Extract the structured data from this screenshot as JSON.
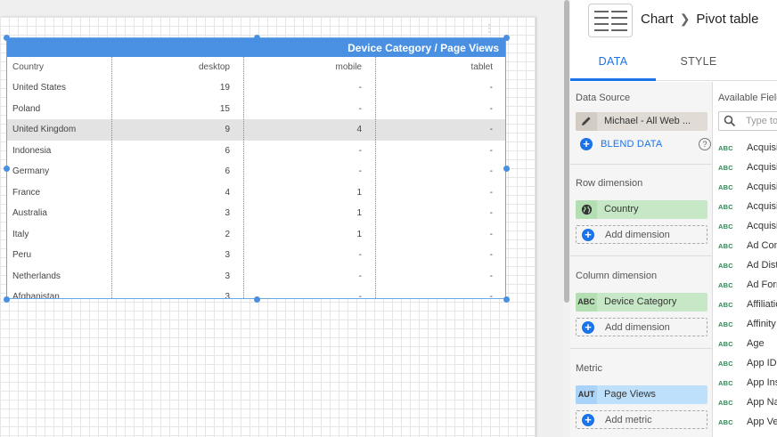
{
  "chart": {
    "header": "Device Category / Page Views",
    "columns": [
      "Country",
      "desktop",
      "mobile",
      "tablet"
    ],
    "rows": [
      [
        "United States",
        "19",
        "-",
        "-"
      ],
      [
        "Poland",
        "15",
        "-",
        "-"
      ],
      [
        "United Kingdom",
        "9",
        "4",
        "-"
      ],
      [
        "Indonesia",
        "6",
        "-",
        "-"
      ],
      [
        "Germany",
        "6",
        "-",
        "-"
      ],
      [
        "France",
        "4",
        "1",
        "-"
      ],
      [
        "Australia",
        "3",
        "1",
        "-"
      ],
      [
        "Italy",
        "2",
        "1",
        "-"
      ],
      [
        "Peru",
        "3",
        "-",
        "-"
      ],
      [
        "Netherlands",
        "3",
        "-",
        "-"
      ],
      [
        "Afghanistan",
        "3",
        "-",
        "-"
      ]
    ]
  },
  "panel": {
    "breadcrumb": {
      "parent": "Chart",
      "current": "Pivot table"
    },
    "tabs": [
      {
        "label": "DATA"
      },
      {
        "label": "STYLE"
      }
    ],
    "data_source": {
      "title": "Data Source",
      "name": "Michael - All Web ...",
      "blend_label": "BLEND DATA"
    },
    "row_dimension": {
      "title": "Row dimension",
      "chip": "Country",
      "add_label": "Add dimension"
    },
    "column_dimension": {
      "title": "Column dimension",
      "chip_type": "ABC",
      "chip": "Device Category",
      "add_label": "Add dimension"
    },
    "metric": {
      "title": "Metric",
      "chip_type": "AUT",
      "chip": "Page Views",
      "add_label": "Add metric"
    },
    "fields": {
      "title": "Available Fields",
      "search_placeholder": "Type to search",
      "items": [
        {
          "type": "ABC",
          "name": "Acquisition Campaign"
        },
        {
          "type": "ABC",
          "name": "Acquisition Medium"
        },
        {
          "type": "ABC",
          "name": "Acquisition Source"
        },
        {
          "type": "ABC",
          "name": "Acquisition Source / Medium"
        },
        {
          "type": "ABC",
          "name": "Acquisition Channel"
        },
        {
          "type": "ABC",
          "name": "Ad Content"
        },
        {
          "type": "ABC",
          "name": "Ad Distribution Network"
        },
        {
          "type": "ABC",
          "name": "Ad Format"
        },
        {
          "type": "ABC",
          "name": "Affiliation"
        },
        {
          "type": "ABC",
          "name": "Affinity Category"
        },
        {
          "type": "ABC",
          "name": "Age"
        },
        {
          "type": "ABC",
          "name": "App ID"
        },
        {
          "type": "ABC",
          "name": "App Installer ID"
        },
        {
          "type": "ABC",
          "name": "App Name"
        },
        {
          "type": "ABC",
          "name": "App Version"
        }
      ]
    }
  }
}
